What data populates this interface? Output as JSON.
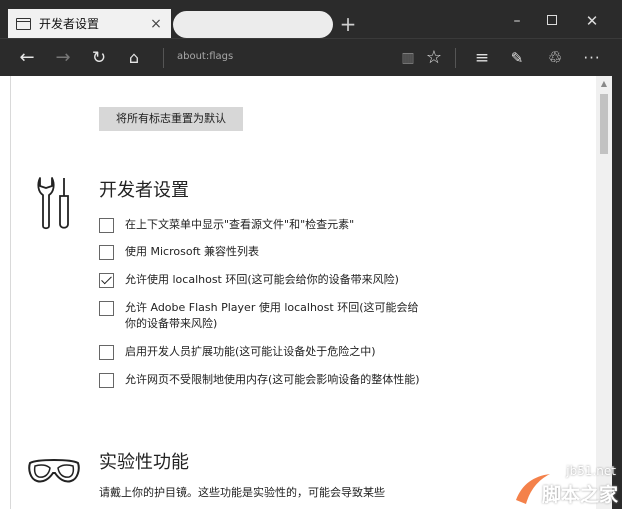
{
  "browser": {
    "tab_title": "开发者设置",
    "tab_close": "×",
    "new_tab": "+",
    "address": "about:flags",
    "window": {
      "minimize": "–",
      "close": "✕"
    },
    "nav": {
      "back": "←",
      "forward": "→",
      "refresh": "↻",
      "home": "⌂"
    },
    "tools": {
      "reading": "▥",
      "favorite": "☆",
      "hub": "≡",
      "note": "✎",
      "share": "♲",
      "more": "···"
    }
  },
  "page": {
    "reset_button": "将所有标志重置为默认",
    "developer": {
      "title": "开发者设置",
      "options": [
        {
          "label": "在上下文菜单中显示\"查看源文件\"和\"检查元素\"",
          "checked": false
        },
        {
          "label": "使用 Microsoft 兼容性列表",
          "checked": false
        },
        {
          "label": "允许使用 localhost 环回(这可能会给你的设备带来风险)",
          "checked": true
        },
        {
          "label": "允许 Adobe Flash Player 使用 localhost 环回(这可能会给你的设备带来风险)",
          "checked": false
        },
        {
          "label": "启用开发人员扩展功能(这可能让设备处于危险之中)",
          "checked": false
        },
        {
          "label": "允许网页不受限制地使用内存(这可能会影响设备的整体性能)",
          "checked": false
        }
      ]
    },
    "experimental": {
      "title": "实验性功能",
      "description": "请戴上你的护目镜。这些功能是实验性的，可能会导致某些"
    }
  },
  "watermark": {
    "site": "jb51.net",
    "name": "脚本之家"
  },
  "colors": {
    "chrome": "#2b2b2b",
    "tab_active": "#f1f1f1",
    "button_bg": "#d7d7d7",
    "watermark": "#f26b2a"
  }
}
